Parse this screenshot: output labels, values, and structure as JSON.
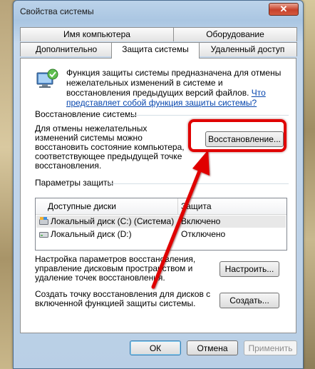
{
  "window": {
    "title": "Свойства системы",
    "close_glyph": "✕"
  },
  "tabs": {
    "row_back": [
      "Имя компьютера",
      "Оборудование"
    ],
    "row_front": [
      "Дополнительно",
      "Защита системы",
      "Удаленный доступ"
    ],
    "active": "Защита системы"
  },
  "info": {
    "text": "Функция защиты системы предназначена для отмены нежелательных изменений в системе и восстановления предыдущих версий файлов. ",
    "link": "Что представляет собой функция защиты системы?"
  },
  "restore": {
    "title": "Восстановление системы",
    "description": "Для отмены нежелательных изменений системы можно восстановить состояние компьютера, соответствующее предыдущей точке восстановления.",
    "button": "Восстановление..."
  },
  "protection": {
    "title": "Параметры защиты",
    "columns": [
      "Доступные диски",
      "Защита"
    ],
    "disks": [
      {
        "name": "Локальный диск (C:) (Система)",
        "status": "Включено",
        "icon": "system-drive-icon"
      },
      {
        "name": "Локальный диск (D:)",
        "status": "Отключено",
        "icon": "drive-icon"
      }
    ],
    "configure_text": "Настройка параметров восстановления, управление дисковым пространством и удаление точек восстановления.",
    "configure_button": "Настроить...",
    "create_text": "Создать точку восстановления для дисков с включенной функцией защиты системы.",
    "create_button": "Создать..."
  },
  "footer": {
    "ok": "ОК",
    "cancel": "Отмена",
    "apply": "Применить"
  },
  "colors": {
    "annotation": "#e00000",
    "link": "#0645ad"
  }
}
